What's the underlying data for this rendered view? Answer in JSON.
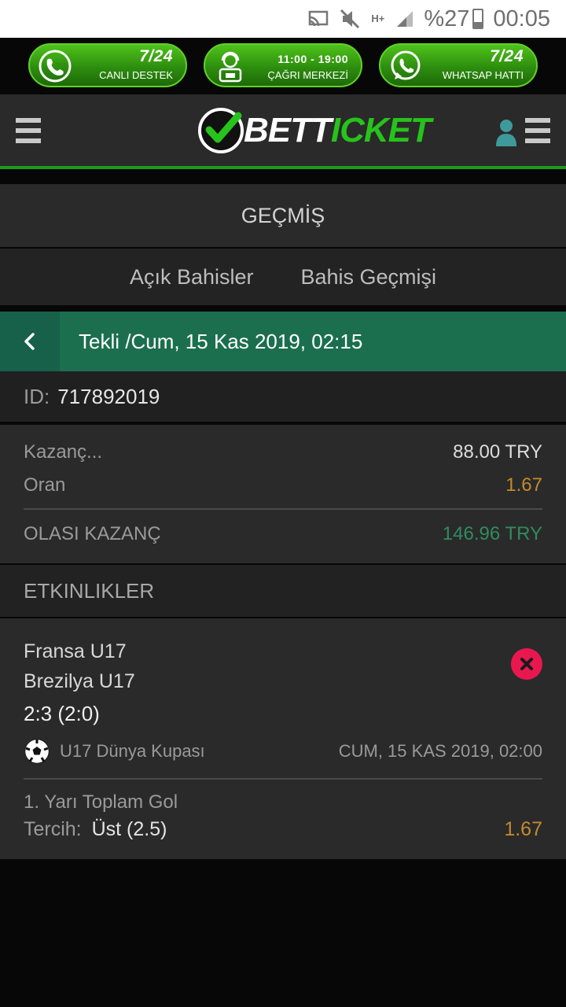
{
  "status_bar": {
    "battery": "%27",
    "time": "00:05",
    "network": "H+"
  },
  "promo": [
    {
      "top": "7/24",
      "bottom": "CANLI DESTEK",
      "icon": "phone-24-icon"
    },
    {
      "top": "11:00 - 19:00",
      "bottom": "ÇAĞRI MERKEZİ",
      "icon": "call-center-agent-icon"
    },
    {
      "top": "7/24",
      "bottom": "WHATSAP HATTI",
      "icon": "whatsapp-icon"
    }
  ],
  "header": {
    "logo_bet": "BET",
    "logo_ticket": "ICKET"
  },
  "page": {
    "title": "GEÇMİŞ",
    "tabs": [
      "Açık Bahisler",
      "Bahis Geçmişi"
    ]
  },
  "ticket": {
    "title": "Tekli /Cum, 15 Kas 2019, 02:15",
    "id_label": "ID:",
    "id_value": "717892019",
    "stake_label": "Kazanç...",
    "stake_value": "88.00 TRY",
    "odds_label": "Oran",
    "odds_value": "1.67",
    "potential_label": "OLASI KAZANÇ",
    "potential_value": "146.96 TRY"
  },
  "events": {
    "title": "ETKINLIKLER",
    "items": [
      {
        "home": "Fransa U17",
        "away": "Brezilya U17",
        "score": "2:3 (2:0)",
        "league": "U17 Dünya Kupası",
        "date": "CUM, 15 KAS 2019, 02:00",
        "market": "1. Yarı Toplam Gol",
        "pick_label": "Tercih:",
        "pick_value": "Üst (2.5)",
        "odd": "1.67",
        "status": "lost"
      }
    ]
  },
  "colors": {
    "brand_green": "#27c21b",
    "ticket_header": "#1b6f4e",
    "odds": "#c38a2e",
    "win": "#2f8c5e",
    "lost": "#e8184f"
  }
}
